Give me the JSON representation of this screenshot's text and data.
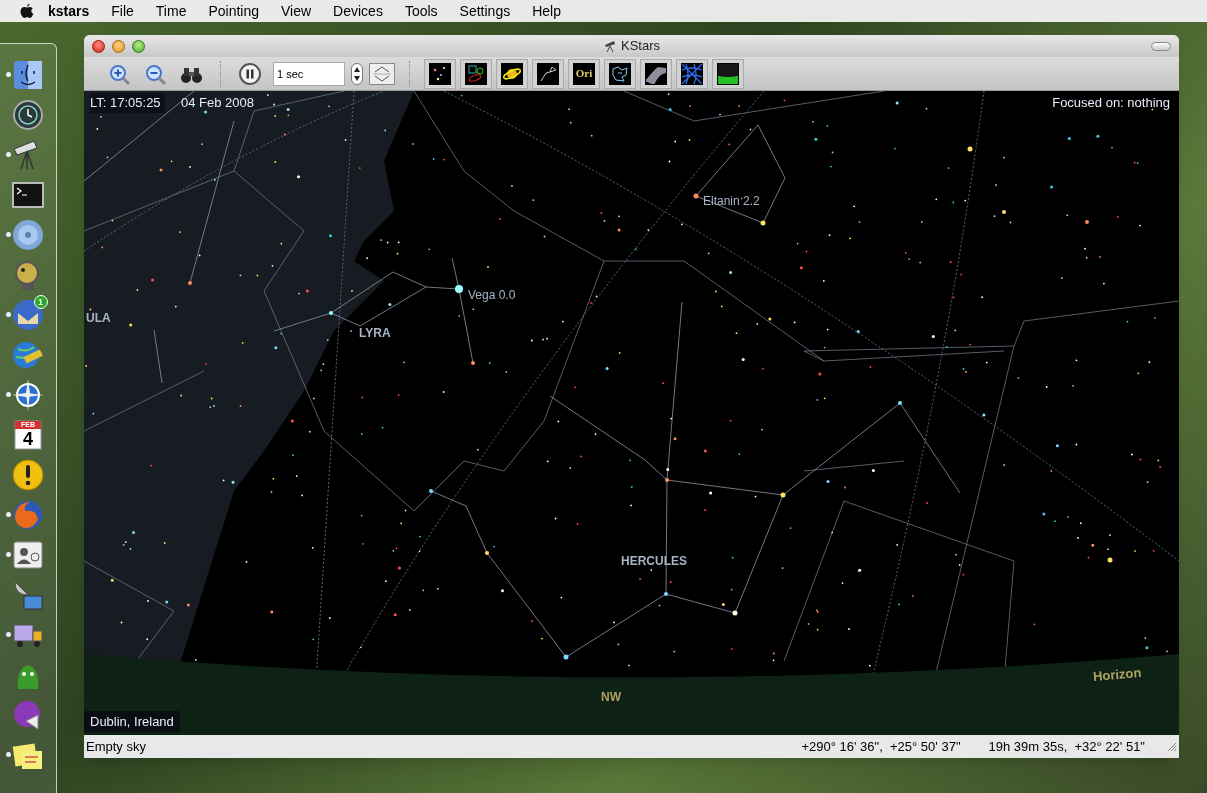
{
  "menubar": {
    "app": "kstars",
    "items": [
      "File",
      "Time",
      "Pointing",
      "View",
      "Devices",
      "Tools",
      "Settings",
      "Help"
    ]
  },
  "dock": {
    "items": [
      {
        "kind": "finder",
        "running": true
      },
      {
        "kind": "clock",
        "running": false
      },
      {
        "kind": "telescope",
        "running": true
      },
      {
        "kind": "terminal",
        "running": false
      },
      {
        "kind": "disc",
        "running": true
      },
      {
        "kind": "gecko",
        "running": false
      },
      {
        "kind": "mail",
        "running": true,
        "badge": "1"
      },
      {
        "kind": "globe",
        "running": false
      },
      {
        "kind": "compass",
        "running": true
      },
      {
        "kind": "calendar",
        "running": false,
        "month": "FEB",
        "day": "4"
      },
      {
        "kind": "alert",
        "running": false
      },
      {
        "kind": "firefox",
        "running": true
      },
      {
        "kind": "contacts",
        "running": true
      },
      {
        "kind": "dish",
        "running": false
      },
      {
        "kind": "truck",
        "running": true
      },
      {
        "kind": "monster",
        "running": false
      },
      {
        "kind": "megaphone",
        "running": false
      },
      {
        "kind": "notes",
        "running": true
      }
    ]
  },
  "window": {
    "title": "KStars"
  },
  "toolbar": {
    "actions": [
      {
        "kind": "zoom-in"
      },
      {
        "kind": "zoom-out"
      },
      {
        "kind": "binoculars"
      },
      {
        "kind": "pause"
      }
    ],
    "time_step": {
      "value": "1 sec"
    },
    "toggles": [
      {
        "kind": "stars"
      },
      {
        "kind": "deep-sky"
      },
      {
        "kind": "planets"
      },
      {
        "kind": "lines"
      },
      {
        "kind": "names",
        "label": "Ori"
      },
      {
        "kind": "boundaries"
      },
      {
        "kind": "milky-way"
      },
      {
        "kind": "grid"
      },
      {
        "kind": "ground"
      }
    ]
  },
  "sky": {
    "time": "LT: 17:05:25",
    "date": "04 Feb 2008",
    "focus": "Focused on: nothing",
    "labels": [
      {
        "kind": "star",
        "text": "Eltanin 2.2"
      },
      {
        "kind": "star",
        "text": "Vega 0.0"
      },
      {
        "kind": "constellation",
        "text": "ULA"
      },
      {
        "kind": "constellation",
        "text": "LYRA"
      },
      {
        "kind": "constellation",
        "text": "HERCULES"
      },
      {
        "kind": "compass",
        "text": "NW"
      },
      {
        "kind": "horizon",
        "text": "Horizon"
      }
    ],
    "location": "Dublin, Ireland"
  },
  "status_bar": {
    "message": "Empty sky",
    "horizontal": "+290° 16' 36\",  +25° 50' 37\"",
    "equatorial": "19h 39m 35s,  +32° 22' 51\""
  }
}
